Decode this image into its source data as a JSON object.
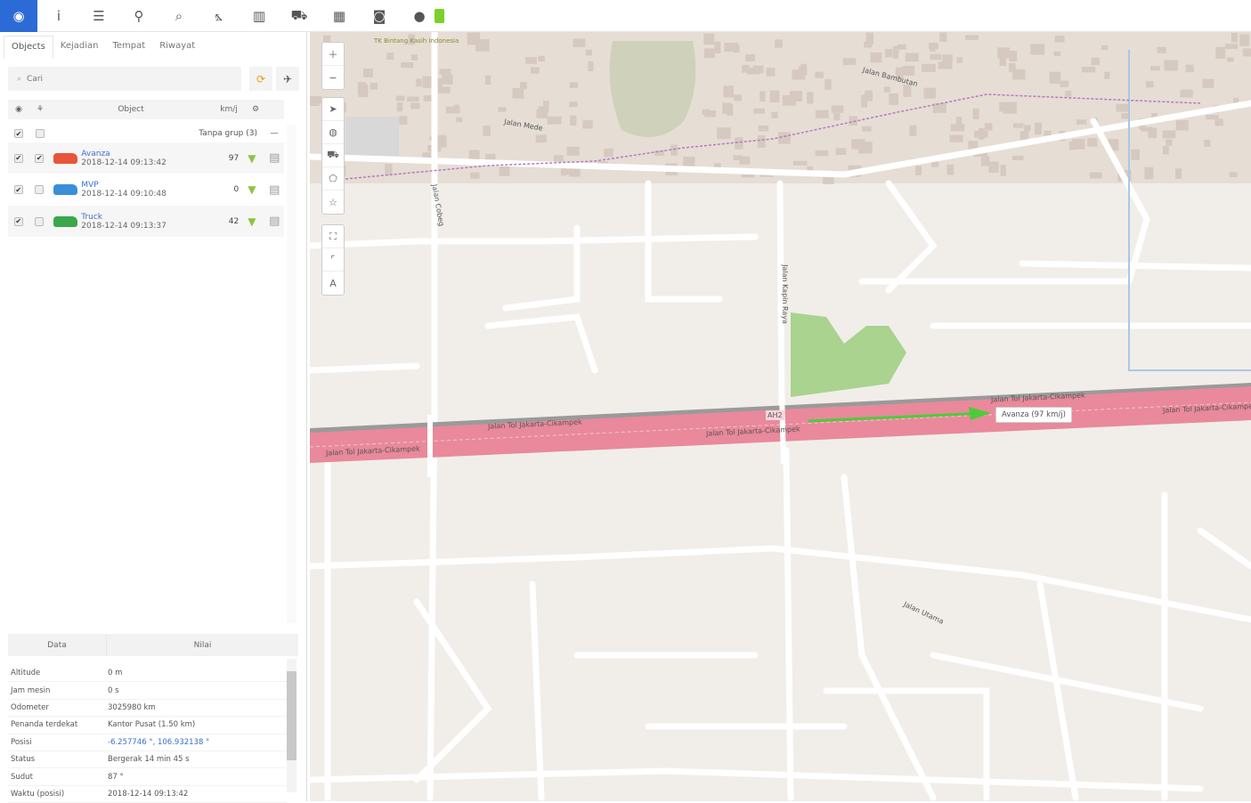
{
  "toolbar": {
    "items": [
      {
        "icon": "globe-icon",
        "glyph": "◉"
      },
      {
        "icon": "info-icon",
        "glyph": "i"
      },
      {
        "icon": "menu-icon",
        "glyph": "☰"
      },
      {
        "icon": "marker-icon",
        "glyph": "⚲"
      },
      {
        "icon": "search-icon",
        "glyph": "⌕"
      },
      {
        "icon": "chart-icon",
        "glyph": "⦩"
      },
      {
        "icon": "book-icon",
        "glyph": "▥"
      },
      {
        "icon": "car-icon",
        "glyph": "⛟"
      },
      {
        "icon": "calendar-icon",
        "glyph": "▦"
      },
      {
        "icon": "camera-icon",
        "glyph": "◙"
      },
      {
        "icon": "chat-icon",
        "glyph": "●"
      }
    ],
    "battery_color": "#7bd02c"
  },
  "tabs": [
    "Objects",
    "Kejadian",
    "Tempat",
    "Riwayat"
  ],
  "search": {
    "placeholder": "Cari"
  },
  "objects_header": {
    "name": "Object",
    "speed": "km/j"
  },
  "group": {
    "label": "Tanpa grup (3)",
    "collapse": "—"
  },
  "objects": [
    {
      "name": "Avanza",
      "time": "2018-12-14 09:13:42",
      "speed": "97",
      "color": "#e8553a",
      "checked": true,
      "followed": true
    },
    {
      "name": "MVP",
      "time": "2018-12-14 09:10:48",
      "speed": "0",
      "color": "#3a8fd8",
      "checked": true,
      "followed": false
    },
    {
      "name": "Truck",
      "time": "2018-12-14 09:13:37",
      "speed": "42",
      "color": "#3aa74a",
      "checked": true,
      "followed": false
    }
  ],
  "details": {
    "headers": [
      "Data",
      "Nilai"
    ],
    "rows": [
      {
        "k": "Altitude",
        "v": "0 m"
      },
      {
        "k": "Jam mesin",
        "v": "0 s"
      },
      {
        "k": "Odometer",
        "v": "3025980 km"
      },
      {
        "k": "Penanda terdekat",
        "v": "Kantor Pusat (1.50 km)"
      },
      {
        "k": "Posisi",
        "v": "-6.257746 °, 106.932138 °",
        "link": true
      },
      {
        "k": "Status",
        "v": "Bergerak 14 min 45 s"
      },
      {
        "k": "Sudut",
        "v": "87 °"
      },
      {
        "k": "Waktu (posisi)",
        "v": "2018-12-14 09:13:42"
      }
    ]
  },
  "map": {
    "labels": {
      "highway1": "Jalan Tol Jakarta-Cikampek",
      "highway2": "Jalan Tol Jakarta-Cikampek",
      "highway3": "Jalan Tol Jakarta-Cikampek",
      "highway4": "Jalan Tol Jakarta-Cikampek",
      "highway5": "Jalan Tol Jakarta-Cikampek",
      "ah": "AH2",
      "kapin": "Jalan Kapin Raya",
      "cibubur": "Jalan Cobeg",
      "bambutan": "Jalan Bambutan",
      "utama": "Jalan Utama",
      "mede": "Jalan Mede",
      "school": "TK Bintang Kasih Indonesia"
    },
    "popup": "Avanza (97 km/j)",
    "colors": {
      "highway": "#e9899b",
      "park": "#a9d38f",
      "arrow": "#4ccc3a",
      "boundary": "#b57ac0"
    }
  }
}
